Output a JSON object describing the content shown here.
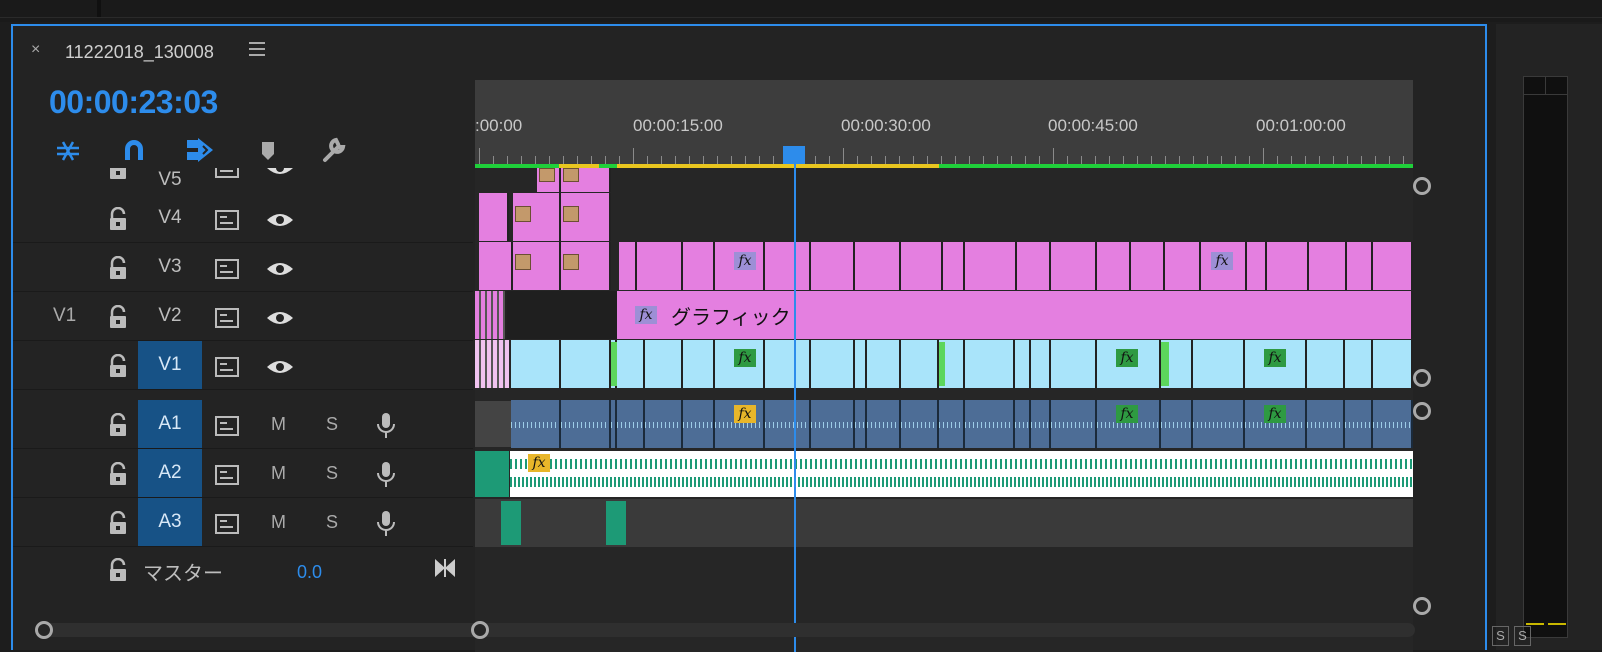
{
  "window": {
    "sequence_name": "11222018_130008",
    "close_label": "×",
    "timecode": "00:00:23:03"
  },
  "ruler": {
    "labels": [
      ":00:00",
      "00:00:15:00",
      "00:00:30:00",
      "00:00:45:00",
      "00:01:00:00"
    ]
  },
  "tracks": {
    "video": [
      {
        "name": "V5",
        "source": ""
      },
      {
        "name": "V4",
        "source": ""
      },
      {
        "name": "V3",
        "source": ""
      },
      {
        "name": "V2",
        "source": "V1"
      },
      {
        "name": "V1",
        "source": "",
        "active": true
      }
    ],
    "audio": [
      {
        "name": "A1",
        "m": "M",
        "s": "S"
      },
      {
        "name": "A2",
        "m": "M",
        "s": "S"
      },
      {
        "name": "A3",
        "m": "M",
        "s": "S"
      }
    ],
    "master": {
      "label": "マスター",
      "value": "0.0"
    }
  },
  "clips": {
    "graphic_label": "グラフィック",
    "fx_label": "fx"
  },
  "meter": {
    "solo_labels": [
      "S",
      "S"
    ]
  },
  "colors": {
    "accent": "#2d8ceb",
    "video_clip": "#e47fe0",
    "v1_clip": "#a9e4fa",
    "audio_clip": "#4d6d96",
    "active_track": "#175286"
  }
}
